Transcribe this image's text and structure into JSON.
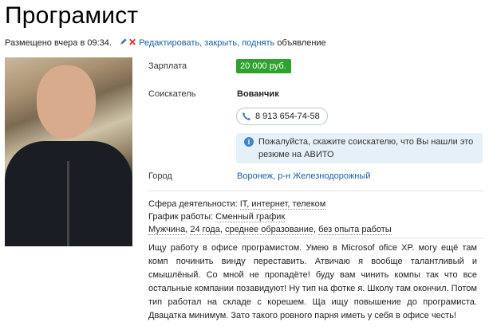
{
  "title": "Програмист",
  "meta": {
    "posted": "Размещено вчера в 09:34.",
    "actions": [
      "Редактировать",
      "закрыть",
      "поднять"
    ],
    "suffix": "объявление"
  },
  "fields": {
    "salary_label": "Зарплата",
    "salary_value": "20 000 руб.",
    "applicant_label": "Соискатель",
    "applicant_name": "Вованчик",
    "phone": "8 913 654-74-58",
    "notice": "Пожалуйста, скажите соискателю, что Вы нашли это резюме на АВИТО",
    "city_label": "Город",
    "city_value": "Воронеж, р-н Железнодорожный"
  },
  "params": {
    "sphere_label": "Сфера деятельности:",
    "sphere_values": [
      "IT, интернет, телеком"
    ],
    "schedule_label": "График работы:",
    "schedule_value": "Сменный график",
    "person": [
      "Мужчина",
      "24 года",
      "среднее образование",
      "без опыта работы"
    ]
  },
  "description": "Ищу работу в офисе програмистом. Умею в Microsof ofice XP. могу ещё там комп починить винду переставить. Атвичаю я вообще талантливый и смышлёный. Со мной не пропадёте! буду вам чинить компы так что все остальные компании позавидуют! Ну тип на фотке я. Школу там окончил. Потом тип работал на складе с корешем. Ща ищу повышение до програмиста. Двацатка минимум. Зато такого ровного парня иметь у себя в офисе честь!",
  "colors": {
    "link": "#1a5fa8",
    "salary_bg": "#2ea12e",
    "notice_bg": "#e6f0f8"
  },
  "icons": [
    "pencil-icon",
    "delete-icon",
    "zoom-icon",
    "phone-icon",
    "info-icon"
  ]
}
